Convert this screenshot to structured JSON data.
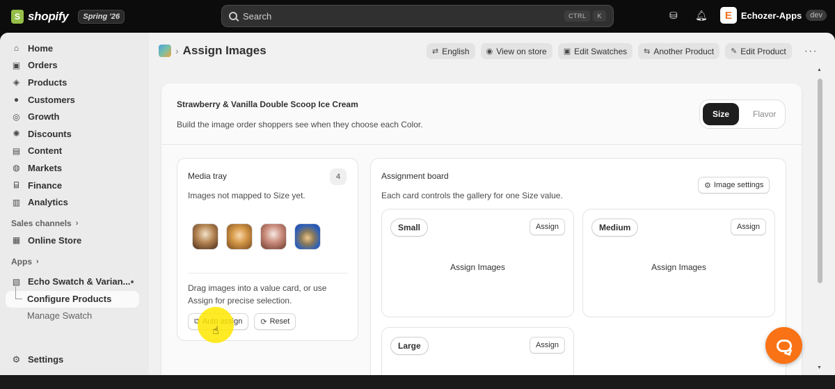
{
  "topbar": {
    "brand": "shopify",
    "edition": "Spring '26",
    "search_placeholder": "Search",
    "shortcut": [
      "CTRL",
      "K"
    ],
    "store_name": "Echozer-Apps",
    "store_initial": "E",
    "env_badge": "dev"
  },
  "sidebar": {
    "items": [
      {
        "label": "Home",
        "icon": "home-icon",
        "glyph": "⌂"
      },
      {
        "label": "Orders",
        "icon": "inbox-icon",
        "glyph": "▣"
      },
      {
        "label": "Products",
        "icon": "tag-icon",
        "glyph": "◈"
      },
      {
        "label": "Customers",
        "icon": "person-icon",
        "glyph": "●"
      },
      {
        "label": "Growth",
        "icon": "target-icon",
        "glyph": "◎"
      },
      {
        "label": "Discounts",
        "icon": "discount-icon",
        "glyph": "✺"
      },
      {
        "label": "Content",
        "icon": "content-icon",
        "glyph": "▤"
      },
      {
        "label": "Markets",
        "icon": "globe-icon",
        "glyph": "◍"
      },
      {
        "label": "Finance",
        "icon": "bank-icon",
        "glyph": "⌸"
      },
      {
        "label": "Analytics",
        "icon": "chart-icon",
        "glyph": "▥"
      }
    ],
    "sales_channels_label": "Sales channels",
    "online_store_label": "Online Store",
    "apps_label": "Apps",
    "app_name": "Echo Swatch & Varian...",
    "configure_products": "Configure Products",
    "manage_swatch": "Manage Swatch",
    "settings_label": "Settings"
  },
  "header": {
    "title": "Assign Images",
    "actions": {
      "english": "English",
      "view_on_store": "View on store",
      "edit_swatches": "Edit Swatches",
      "another_product": "Another Product",
      "edit_product": "Edit Product"
    },
    "more": "···"
  },
  "product": {
    "name": "Strawberry & Vanilla Double Scoop Ice Cream",
    "description": "Build the image order shoppers see when they choose each Color.",
    "segments": [
      "Size",
      "Flavor"
    ],
    "selected_segment": "Size"
  },
  "tray": {
    "title": "Media tray",
    "count": "4",
    "subtitle": "Images not mapped to Size yet.",
    "help": "Drag images into a value card, or use Assign for precise selection.",
    "auto_assign": "Auto assign",
    "reset": "Reset"
  },
  "board": {
    "title": "Assignment board",
    "subtitle": "Each card controls the gallery for one Size value.",
    "image_settings": "Image settings",
    "assign_label": "Assign",
    "cta": "Assign Images",
    "values": [
      "Small",
      "Medium",
      "Large"
    ]
  },
  "colors": {
    "accent_chat": "#f97316",
    "cursor_highlight": "#ffe600",
    "topbar_bg": "#0c0c0c"
  }
}
